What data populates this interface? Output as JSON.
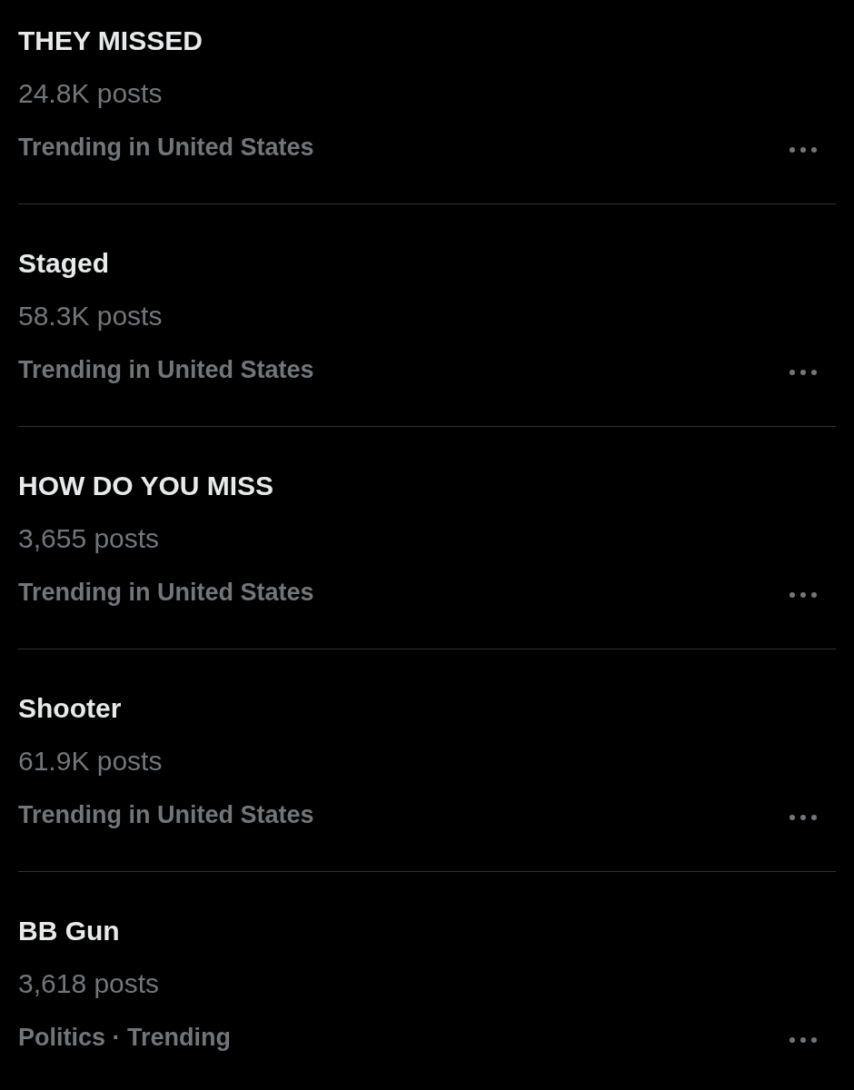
{
  "trends": [
    {
      "title": "THEY MISSED",
      "posts": "24.8K posts",
      "context": "Trending in United States"
    },
    {
      "title": "Staged",
      "posts": "58.3K posts",
      "context": "Trending in United States"
    },
    {
      "title": "HOW DO YOU MISS",
      "posts": "3,655 posts",
      "context": "Trending in United States"
    },
    {
      "title": "Shooter",
      "posts": "61.9K posts",
      "context": "Trending in United States"
    },
    {
      "title": "BB Gun",
      "posts": "3,618 posts",
      "context": "Politics · Trending"
    }
  ]
}
